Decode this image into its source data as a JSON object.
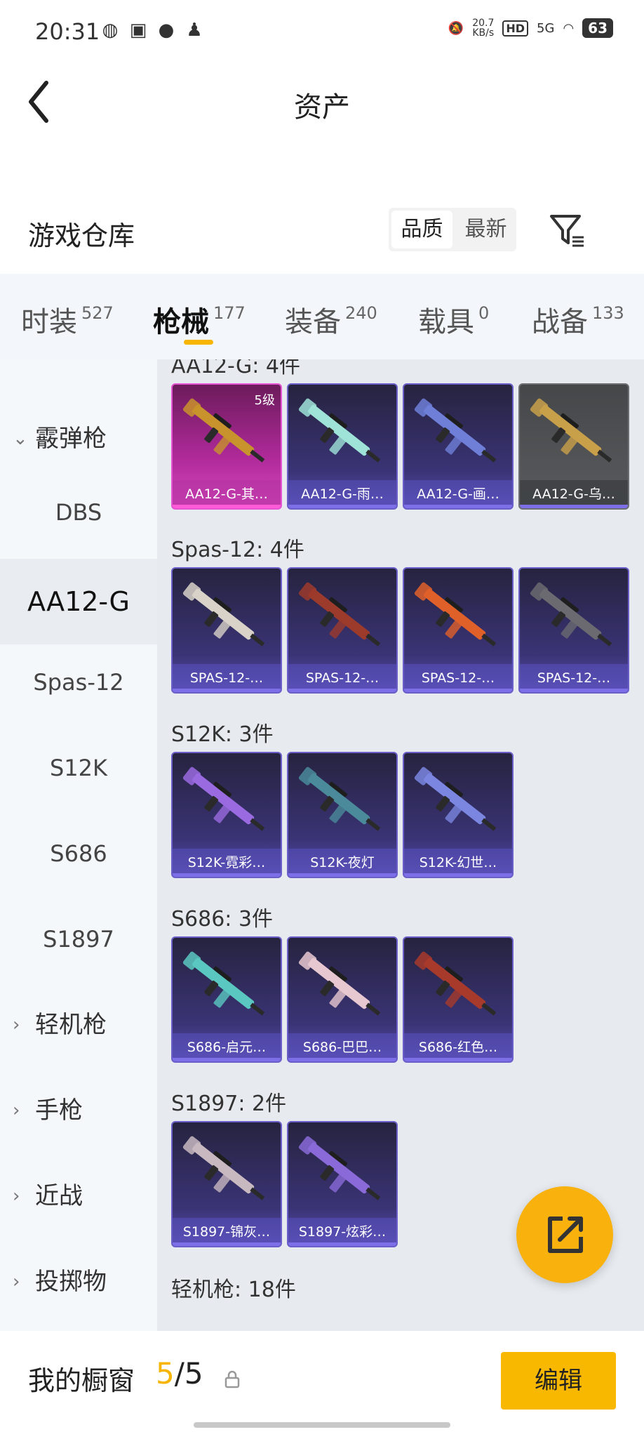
{
  "status_bar": {
    "time": "20:31",
    "net_speed": "20.7\nKB/s",
    "hd": "HD",
    "signal": "5G",
    "battery": "63"
  },
  "header": {
    "title": "资产"
  },
  "warehouse": {
    "title": "游戏仓库",
    "sort_options": [
      "品质",
      "最新"
    ],
    "active_sort": "品质"
  },
  "categories": [
    {
      "label": "时装",
      "count": "527"
    },
    {
      "label": "枪械",
      "count": "177"
    },
    {
      "label": "装备",
      "count": "240"
    },
    {
      "label": "载具",
      "count": "0"
    },
    {
      "label": "战备",
      "count": "133"
    }
  ],
  "sidebar": {
    "items": [
      {
        "label": "霰弹枪",
        "type": "group"
      },
      {
        "label": "DBS",
        "type": "item"
      },
      {
        "label": "AA12-G",
        "type": "item"
      },
      {
        "label": "Spas-12",
        "type": "item"
      },
      {
        "label": "S12K",
        "type": "item"
      },
      {
        "label": "S686",
        "type": "item"
      },
      {
        "label": "S1897",
        "type": "item"
      },
      {
        "label": "轻机枪",
        "type": "group"
      },
      {
        "label": "手枪",
        "type": "group"
      },
      {
        "label": "近战",
        "type": "group"
      },
      {
        "label": "投掷物",
        "type": "group"
      }
    ],
    "active": "AA12-G"
  },
  "groups": [
    {
      "label": "AA12-G: 4件",
      "items": [
        {
          "name": "AA12-G-其…",
          "level": "5级",
          "rarity": "pink",
          "gun_color": "#c8922c"
        },
        {
          "name": "AA12-G-雨…",
          "rarity": "purple",
          "gun_color": "#9fe3d8"
        },
        {
          "name": "AA12-G-画…",
          "rarity": "purple",
          "gun_color": "#6f7fd8"
        },
        {
          "name": "AA12-G-乌…",
          "rarity": "gray",
          "gun_color": "#c9a04a"
        }
      ]
    },
    {
      "label": "Spas-12: 4件",
      "items": [
        {
          "name": "SPAS-12-…",
          "rarity": "purple",
          "gun_color": "#d8d2c8"
        },
        {
          "name": "SPAS-12-…",
          "rarity": "purple",
          "gun_color": "#9c3a2c"
        },
        {
          "name": "SPAS-12-…",
          "rarity": "purple",
          "gun_color": "#e0602a"
        },
        {
          "name": "SPAS-12-…",
          "rarity": "purple",
          "gun_color": "#6a6a70"
        }
      ]
    },
    {
      "label": "S12K: 3件",
      "items": [
        {
          "name": "S12K-霓彩…",
          "rarity": "purple",
          "gun_color": "#9a6ae0"
        },
        {
          "name": "S12K-夜灯",
          "rarity": "purple",
          "gun_color": "#4a8a9a"
        },
        {
          "name": "S12K-幻世…",
          "rarity": "purple",
          "gun_color": "#7a86e0"
        }
      ]
    },
    {
      "label": "S686: 3件",
      "items": [
        {
          "name": "S686-启元…",
          "rarity": "purple",
          "gun_color": "#5ac8c0"
        },
        {
          "name": "S686-巴巴…",
          "rarity": "purple",
          "gun_color": "#e8c8d0"
        },
        {
          "name": "S686-红色…",
          "rarity": "purple",
          "gun_color": "#a83a2c"
        }
      ]
    },
    {
      "label": "S1897: 2件",
      "items": [
        {
          "name": "S1897-锦灰…",
          "rarity": "purple",
          "gun_color": "#c8b8c0"
        },
        {
          "name": "S1897-炫彩…",
          "rarity": "purple",
          "gun_color": "#8a6ad8"
        }
      ]
    },
    {
      "label": "轻机枪: 18件",
      "items": []
    }
  ],
  "bottom_bar": {
    "showcase_label": "我的橱窗",
    "showcase_current": "5",
    "showcase_sep_total": "/5",
    "edit_label": "编辑"
  },
  "colors": {
    "accent": "#f7b500",
    "rarity_pink": "#e554d2",
    "rarity_purple": "#6a5fc8"
  }
}
